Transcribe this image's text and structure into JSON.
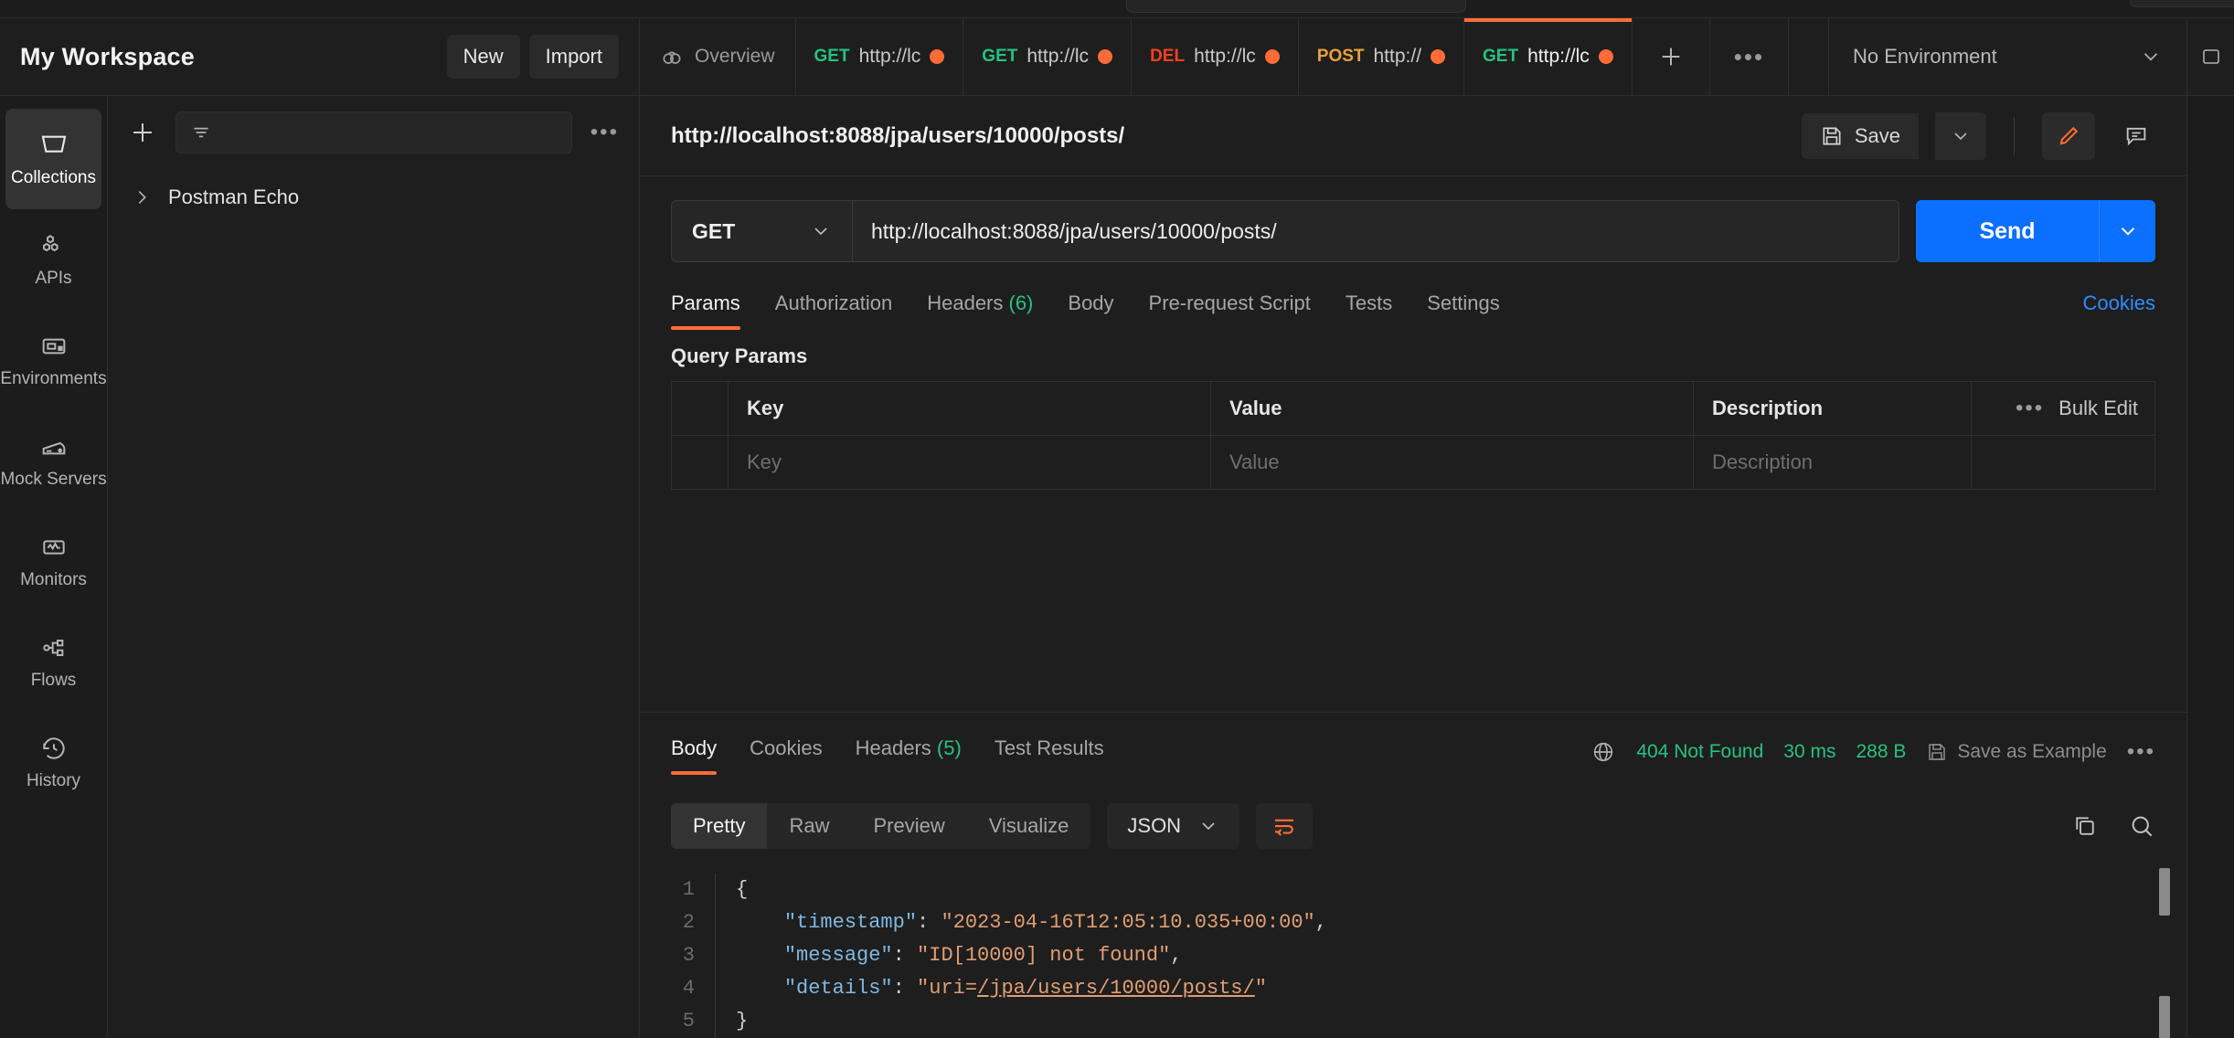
{
  "header": {
    "workspace_title": "My Workspace",
    "new_label": "New",
    "import_label": "Import",
    "environment_label": "No Environment"
  },
  "tabs": [
    {
      "method": "",
      "label": "Overview",
      "icon": "overview-icon",
      "unsaved": false,
      "active": false
    },
    {
      "method": "GET",
      "method_class": "get",
      "label": "http://lc",
      "unsaved": true,
      "active": false
    },
    {
      "method": "GET",
      "method_class": "get",
      "label": "http://lc",
      "unsaved": true,
      "active": false
    },
    {
      "method": "DEL",
      "method_class": "del",
      "label": "http://lc",
      "unsaved": true,
      "active": false
    },
    {
      "method": "POST",
      "method_class": "post",
      "label": "http://",
      "unsaved": true,
      "active": false
    },
    {
      "method": "GET",
      "method_class": "get",
      "label": "http://lc",
      "unsaved": true,
      "active": true
    }
  ],
  "sidebar": {
    "items": [
      {
        "label": "Collections",
        "icon": "collections-icon",
        "active": true
      },
      {
        "label": "APIs",
        "icon": "apis-icon",
        "active": false
      },
      {
        "label": "Environments",
        "icon": "environments-icon",
        "active": false
      },
      {
        "label": "Mock Servers",
        "icon": "mock-servers-icon",
        "active": false
      },
      {
        "label": "Monitors",
        "icon": "monitors-icon",
        "active": false
      },
      {
        "label": "Flows",
        "icon": "flows-icon",
        "active": false
      },
      {
        "label": "History",
        "icon": "history-icon",
        "active": false
      }
    ]
  },
  "collections": {
    "search_placeholder": "",
    "items": [
      {
        "label": "Postman Echo"
      }
    ]
  },
  "request": {
    "title": "http://localhost:8088/jpa/users/10000/posts/",
    "save_label": "Save",
    "method": "GET",
    "url": "http://localhost:8088/jpa/users/10000/posts/",
    "send_label": "Send",
    "cookies_label": "Cookies",
    "tabs": [
      {
        "label": "Params",
        "count": "",
        "active": true
      },
      {
        "label": "Authorization",
        "count": "",
        "active": false
      },
      {
        "label": "Headers",
        "count": "(6)",
        "active": false
      },
      {
        "label": "Body",
        "count": "",
        "active": false
      },
      {
        "label": "Pre-request Script",
        "count": "",
        "active": false
      },
      {
        "label": "Tests",
        "count": "",
        "active": false
      },
      {
        "label": "Settings",
        "count": "",
        "active": false
      }
    ],
    "query_params": {
      "section_title": "Query Params",
      "columns": [
        "Key",
        "Value",
        "Description"
      ],
      "bulk_edit_label": "Bulk Edit",
      "empty_row": {
        "key": "Key",
        "value": "Value",
        "description": "Description"
      }
    }
  },
  "response": {
    "tabs": [
      {
        "label": "Body",
        "count": "",
        "active": true
      },
      {
        "label": "Cookies",
        "count": "",
        "active": false
      },
      {
        "label": "Headers",
        "count": "(5)",
        "active": false
      },
      {
        "label": "Test Results",
        "count": "",
        "active": false
      }
    ],
    "status": "404 Not Found",
    "time": "30 ms",
    "size": "288 B",
    "save_example_label": "Save as Example",
    "format_tabs": [
      {
        "label": "Pretty",
        "active": true
      },
      {
        "label": "Raw",
        "active": false
      },
      {
        "label": "Preview",
        "active": false
      },
      {
        "label": "Visualize",
        "active": false
      }
    ],
    "language": "JSON",
    "body_lines": [
      {
        "no": "1",
        "segments": [
          {
            "t": "{",
            "c": "p"
          }
        ]
      },
      {
        "no": "2",
        "segments": [
          {
            "t": "    ",
            "c": "p"
          },
          {
            "t": "\"timestamp\"",
            "c": "k"
          },
          {
            "t": ": ",
            "c": "p"
          },
          {
            "t": "\"2023-04-16T12:05:10.035+00:00\"",
            "c": "s"
          },
          {
            "t": ",",
            "c": "p"
          }
        ]
      },
      {
        "no": "3",
        "segments": [
          {
            "t": "    ",
            "c": "p"
          },
          {
            "t": "\"message\"",
            "c": "k"
          },
          {
            "t": ": ",
            "c": "p"
          },
          {
            "t": "\"ID[10000] not found\"",
            "c": "s"
          },
          {
            "t": ",",
            "c": "p"
          }
        ]
      },
      {
        "no": "4",
        "segments": [
          {
            "t": "    ",
            "c": "p"
          },
          {
            "t": "\"details\"",
            "c": "k"
          },
          {
            "t": ": ",
            "c": "p"
          },
          {
            "t": "\"uri=",
            "c": "s"
          },
          {
            "t": "/jpa/users/10000/posts/",
            "c": "s uline"
          },
          {
            "t": "\"",
            "c": "s"
          }
        ]
      },
      {
        "no": "5",
        "segments": [
          {
            "t": "}",
            "c": "p"
          }
        ]
      }
    ]
  },
  "colors": {
    "accent": "#ff6c37",
    "send_blue": "#0b6fff",
    "success_green": "#26c281",
    "link_blue": "#2f8cff",
    "method_get": "#26c281",
    "method_del": "#f5401f",
    "method_post": "#e8a13b"
  }
}
